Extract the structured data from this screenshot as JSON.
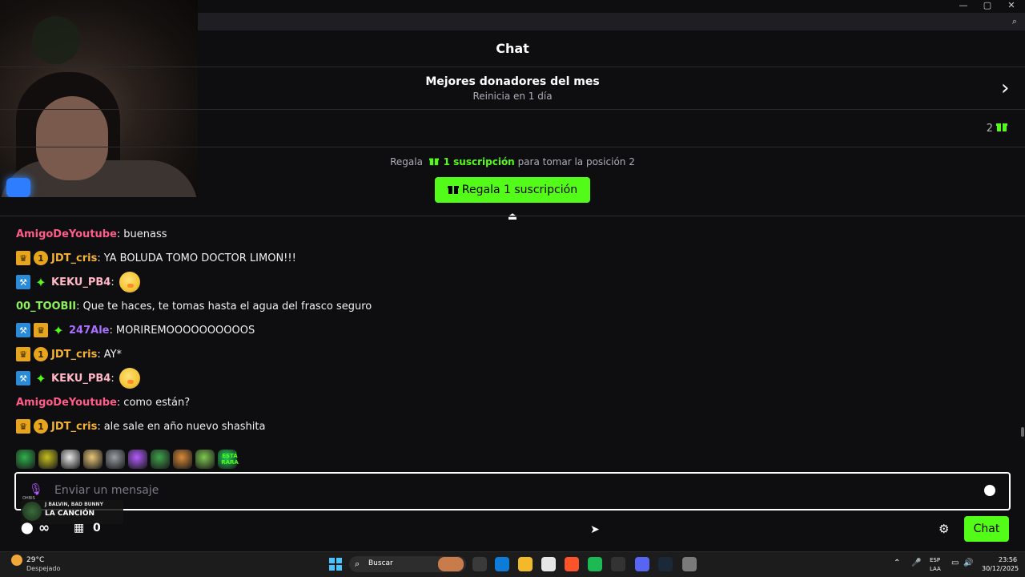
{
  "window": {
    "minimize": "—",
    "maximize": "▢",
    "close": "✕"
  },
  "header": {
    "title": "Chat",
    "donors_title": "Mejores donadores del mes",
    "donors_sub": "Reinicia en 1 día",
    "gift_count": "2"
  },
  "gift": {
    "prompt_before": "Regala",
    "prompt_highlight": "1 suscripción",
    "prompt_after": "para tomar la posición 2",
    "button_label": "Regala 1 suscripción"
  },
  "messages": [
    {
      "badges": [],
      "user": "AmigoDeYoutube",
      "color": "#ff5c8a",
      "text": "buenass",
      "emote": false
    },
    {
      "badges": [
        "crown",
        "one"
      ],
      "user": "JDT_cris",
      "color": "#f5b335",
      "text": "YA BOLUDA TOMO DOCTOR LIMON!!!",
      "emote": false
    },
    {
      "badges": [
        "hammer",
        "spark"
      ],
      "user": "KEKU_PB4",
      "color": "#ffb7c5",
      "text": "",
      "emote": true
    },
    {
      "badges": [],
      "user": "00_TOOBII",
      "color": "#8ef05b",
      "text": "Que te haces, te tomas hasta el agua del frasco seguro",
      "emote": false
    },
    {
      "badges": [
        "hammer",
        "crown",
        "spark"
      ],
      "user": "247Ale",
      "color": "#a970ff",
      "text": "MORIREMOOOOOOOOOOS",
      "emote": false
    },
    {
      "badges": [
        "crown",
        "one"
      ],
      "user": "JDT_cris",
      "color": "#f5b335",
      "text": "AY*",
      "emote": false
    },
    {
      "badges": [
        "hammer",
        "spark"
      ],
      "user": "KEKU_PB4",
      "color": "#ffb7c5",
      "text": "",
      "emote": true
    },
    {
      "badges": [],
      "user": "AmigoDeYoutube",
      "color": "#ff5c8a",
      "text": "como están?",
      "emote": false
    },
    {
      "badges": [
        "crown",
        "one"
      ],
      "user": "JDT_cris",
      "color": "#f5b335",
      "text": "ale sale en año nuevo shashita",
      "emote": false
    }
  ],
  "emotes": [
    "#2fb14d",
    "#c7c01f",
    "#e8e8e8",
    "#e9c67a",
    "#9aa0a6",
    "#b35cff",
    "#3fa34d",
    "#d98b3a",
    "#7ec850",
    "#1fd15c"
  ],
  "emote_text": "ESTÁ RARA",
  "input": {
    "placeholder": "Enviar un mensaje"
  },
  "now_playing": {
    "label": "OHBIS",
    "artist": "J BALVIN, BAD BUNNY",
    "song": "LA CANCIÓN"
  },
  "footer": {
    "points": "∞",
    "store_count": "0",
    "send_label": "Chat"
  },
  "taskbar": {
    "temp": "29°C",
    "condition": "Despejado",
    "search": "Buscar",
    "lang_top": "ESP",
    "lang_bottom": "LAA",
    "time": "23:56",
    "date": "30/12/2025",
    "apps": [
      "#3a3a3a",
      "#0f7bd8",
      "#f2b92b",
      "#e6e6e6",
      "#fb542b",
      "#1db954",
      "#333333",
      "#5865f2",
      "#1b2838",
      "#7a7a7a"
    ]
  }
}
